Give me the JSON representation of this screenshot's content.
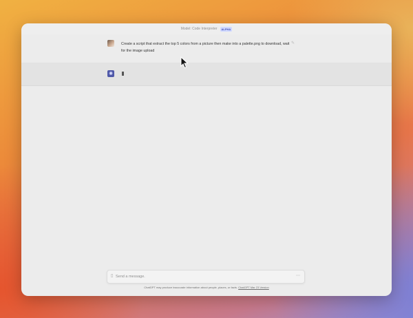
{
  "window": {
    "title": "Model: Code Interpreter",
    "badge": "ALPHA"
  },
  "conversation": {
    "user_message": {
      "text": "Create a script that extract the top 5 colors from a picture then make into a palette.png to download, wait for the image upload",
      "edit_icon": "edit-icon"
    },
    "assistant_message": {
      "avatar_icon": "openai-logo-icon",
      "state": "typing-cursor"
    }
  },
  "composer": {
    "placeholder": "Send a message.",
    "attach_icon": "attach-file-icon",
    "send_icon": "send-icon"
  },
  "footer": {
    "disclaimer": "ChatGPT may produce inaccurate information about people, places, or facts.",
    "version_link": "ChatGPT Mar 23 Version"
  },
  "colors": {
    "accent_badge": "#cfd8ff",
    "assistant_avatar": "#4f58a8",
    "window_bg": "#ececec"
  }
}
